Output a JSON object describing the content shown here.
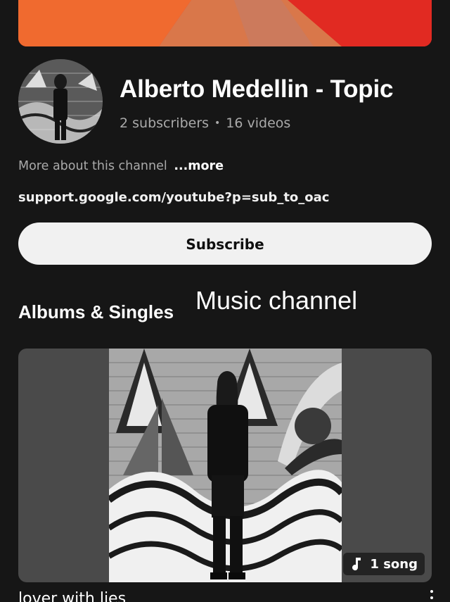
{
  "channel": {
    "title": "Alberto Medellin - Topic",
    "subscribers": "2 subscribers",
    "separator": "•",
    "videos": "16 videos",
    "about_text": "More about this channel",
    "about_more": "...more",
    "link": "support.google.com/youtube?p=sub_to_oac",
    "subscribe_label": "Subscribe"
  },
  "section": {
    "title": "Albums & Singles",
    "overlay_caption": "Music channel"
  },
  "album": {
    "badge_count": "1 song",
    "badge_icon": "music-note-icon",
    "title": "lover with lies"
  },
  "colors": {
    "background": "#161616",
    "banner_red": "#e8372a",
    "subscribe_bg": "#f1f1f1"
  }
}
